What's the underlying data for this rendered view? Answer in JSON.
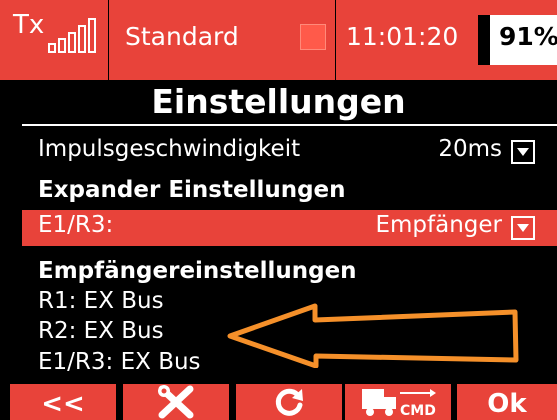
{
  "statusbar": {
    "tx_label": "Tx",
    "signal_level_bars": 5,
    "mode": "Standard",
    "time": "11:01:20",
    "battery": "91%",
    "accent_color": "#e8433a"
  },
  "screen": {
    "title": "Einstellungen",
    "impuls": {
      "label": "Impulsgeschwindigkeit",
      "value": "20ms"
    },
    "expander_heading": "Expander Einstellungen",
    "expander_row": {
      "label": "E1/R3:",
      "value": "Empfänger"
    },
    "receiver_heading": "Empfängereinstellungen",
    "receiver_items": [
      "R1:  EX Bus",
      "R2:  EX Bus",
      "E1/R3:  EX Bus"
    ],
    "annotation_arrow_color": "#f5902a"
  },
  "buttons": {
    "back": "<<",
    "settings_icon": "wrench-cross-icon",
    "refresh_icon": "refresh-icon",
    "cmd_text": "CMD",
    "ok": "Ok"
  }
}
